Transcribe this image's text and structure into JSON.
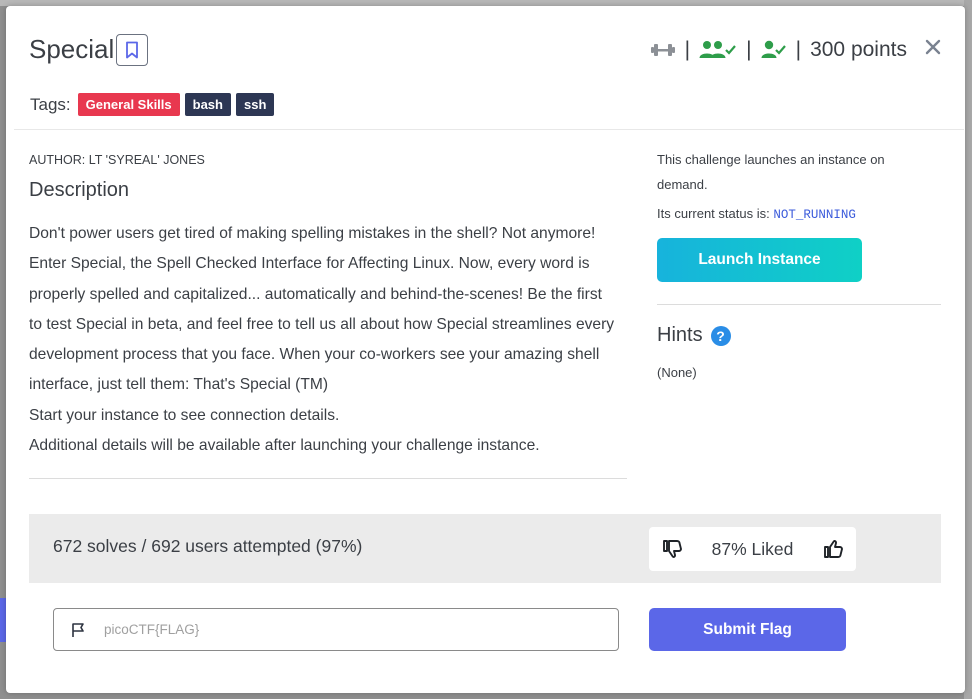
{
  "challenge": {
    "title": "Special",
    "points": "300 points",
    "tags_label": "Tags:",
    "tags": [
      {
        "label": "General Skills",
        "color": "#e8384f"
      },
      {
        "label": "bash",
        "color": "#2d3754"
      },
      {
        "label": "ssh",
        "color": "#2d3754"
      }
    ],
    "author": "AUTHOR: LT 'SYREAL' JONES",
    "description_heading": "Description",
    "description_paragraphs": [
      "Don't power users get tired of making spelling mistakes in the shell? Not anymore! Enter Special, the Spell Checked Interface for Affecting Linux. Now, every word is properly spelled and capitalized... automatically and behind-the-scenes! Be the first to test Special in beta, and feel free to tell us all about how Special streamlines every development process that you face. When your co-workers see your amazing shell interface, just tell them: That's Special (TM)",
      "Start your instance to see connection details.",
      "Additional details will be available after launching your challenge instance."
    ]
  },
  "instance": {
    "info": "This challenge launches an instance on demand.",
    "status_prefix": "Its current status is:",
    "status_value": "NOT_RUNNING",
    "launch_label": "Launch Instance"
  },
  "hints": {
    "heading": "Hints",
    "help_glyph": "?",
    "content": "(None)"
  },
  "stats": {
    "solves": "672 solves / 692 users attempted (97%)",
    "liked": "87% Liked"
  },
  "flag": {
    "placeholder": "picoCTF{FLAG}",
    "value": "",
    "submit_label": "Submit Flag"
  },
  "icons": {
    "difficulty": "dumbbell-icon",
    "team_solved": "users-check-icon",
    "user_solved": "user-check-icon",
    "close": "close-icon",
    "bookmark": "bookmark-icon",
    "dislike": "thumbs-down-icon",
    "like": "thumbs-up-icon",
    "flag": "flag-icon"
  },
  "colors": {
    "accent": "#5b67e8",
    "launch_gradient_start": "#17b3dc",
    "launch_gradient_end": "#0fd0c6",
    "solved_green": "#2e9d4a",
    "tag_red": "#e8384f",
    "tag_dark": "#2d3754",
    "status_blue": "#3b5bdb"
  }
}
